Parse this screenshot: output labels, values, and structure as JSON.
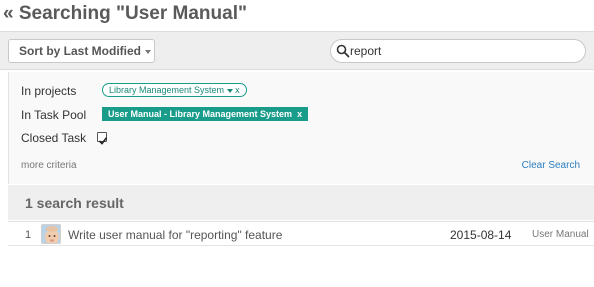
{
  "page": {
    "title": "« Searching \"User Manual\""
  },
  "toolbar": {
    "sort_label": "Sort by Last Modified",
    "search_value": "report"
  },
  "criteria": {
    "projects_label": "In projects",
    "project_tag": "Library Management System",
    "task_pool_label": "In Task Pool",
    "task_pool_tag": "User Manual - Library Management System",
    "closed_task_label": "Closed Task",
    "closed_task_checked": true,
    "tag_remove": "x",
    "more_criteria": "more criteria",
    "clear_search": "Clear Search"
  },
  "results": {
    "count_label": "1 search result",
    "rows": [
      {
        "index": "1",
        "title": "Write user manual for \"reporting\" feature",
        "date": "2015-08-14",
        "pool": "User Manual"
      }
    ]
  },
  "colors": {
    "accent": "#1a9c8a",
    "link": "#2a7dc0"
  },
  "icons": {
    "search": "search-icon",
    "sort_caret": "chevron-down-icon",
    "avatar": "baby-avatar"
  }
}
